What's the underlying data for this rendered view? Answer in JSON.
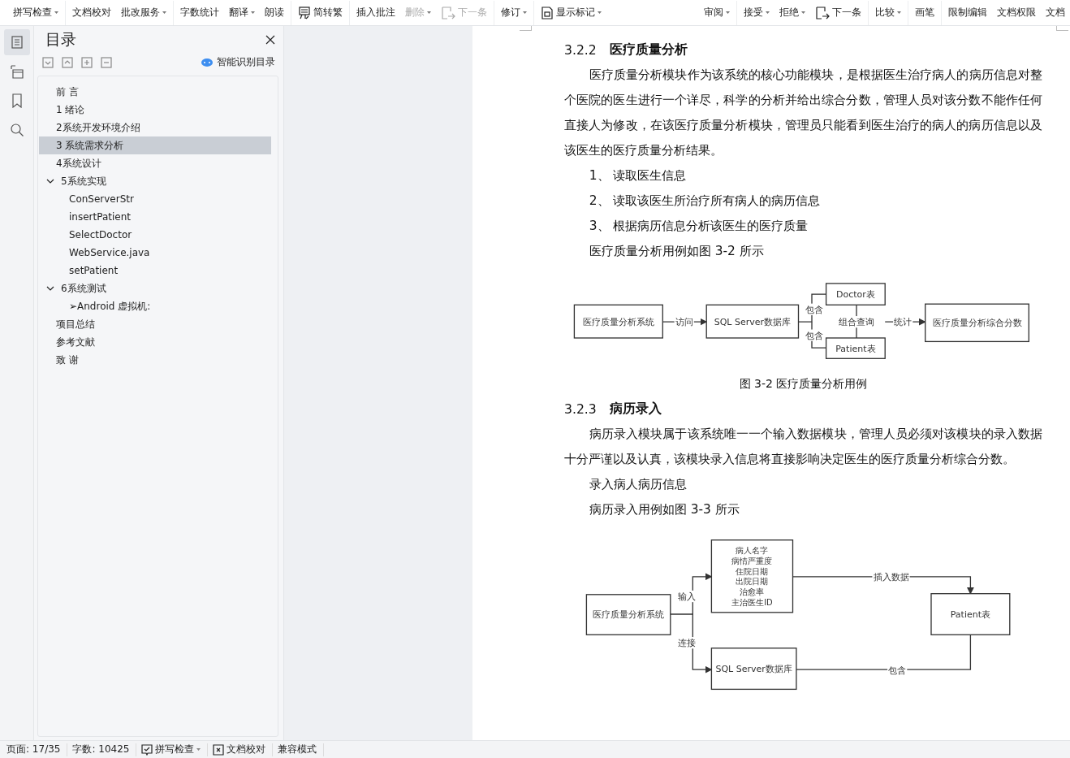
{
  "toolbar": {
    "left": [
      {
        "label": "拼写检查",
        "kind": "dropdown",
        "disabled": false
      },
      {
        "label": "文档校对",
        "kind": "plain",
        "disabled": false
      },
      {
        "label": "批改服务",
        "kind": "dropdown",
        "disabled": false
      },
      {
        "label": "字数统计",
        "kind": "plain",
        "disabled": false
      },
      {
        "label": "翻译",
        "kind": "dropdown",
        "disabled": false
      },
      {
        "label": "朗读",
        "kind": "plain",
        "disabled": false
      },
      {
        "label": "简转繁",
        "kind": "convert",
        "disabled": false
      },
      {
        "label": "插入批注",
        "kind": "plain",
        "disabled": false
      },
      {
        "label": "删除",
        "kind": "dropdown",
        "disabled": true
      },
      {
        "label": "下一条",
        "kind": "next",
        "disabled": true
      },
      {
        "label": "修订",
        "kind": "dropdown",
        "disabled": false
      },
      {
        "label": "显示标记",
        "kind": "markup",
        "disabled": false
      }
    ],
    "right": [
      {
        "label": "审阅",
        "kind": "dropdown",
        "disabled": false
      },
      {
        "label": "接受",
        "kind": "dropdown",
        "disabled": false
      },
      {
        "label": "拒绝",
        "kind": "dropdown",
        "disabled": false
      },
      {
        "label": "下一条",
        "kind": "next",
        "disabled": false
      },
      {
        "label": "比较",
        "kind": "dropdown",
        "disabled": false
      },
      {
        "label": "画笔",
        "kind": "plain",
        "disabled": false
      },
      {
        "label": "限制编辑",
        "kind": "plain",
        "disabled": false
      },
      {
        "label": "文档权限",
        "kind": "plain",
        "disabled": false
      },
      {
        "label": "文档",
        "kind": "plain",
        "disabled": false
      }
    ]
  },
  "rail": [
    {
      "kind": "outline",
      "selected": true
    },
    {
      "kind": "chapters",
      "selected": false
    },
    {
      "kind": "bookmark",
      "selected": false
    },
    {
      "kind": "search",
      "selected": false
    }
  ],
  "toc": {
    "title": "目录",
    "smart_label": "智能识别目录",
    "items": [
      {
        "label": "前 言",
        "selected": false
      },
      {
        "label": "1  绪论",
        "selected": false
      },
      {
        "label": "2系统开发环境介绍",
        "selected": false
      },
      {
        "label": "3  系统需求分析",
        "selected": true
      },
      {
        "label": "4系统设计",
        "selected": false
      },
      {
        "label": "5系统实现",
        "selected": false,
        "expanded": true,
        "children": [
          {
            "label": "ConServerStr",
            "selected": false
          },
          {
            "label": "insertPatient",
            "selected": false
          },
          {
            "label": "SelectDoctor",
            "selected": false
          },
          {
            "label": "WebService.java",
            "selected": false
          },
          {
            "label": "setPatient",
            "selected": false
          }
        ]
      },
      {
        "label": "6系统测试",
        "selected": false,
        "expanded": true,
        "children": [
          {
            "label": "➢Android 虚拟机:",
            "selected": false
          }
        ]
      },
      {
        "label": "项目总结",
        "selected": false
      },
      {
        "label": "参考文献",
        "selected": false
      },
      {
        "label": "致 谢",
        "selected": false
      }
    ]
  },
  "document": {
    "blocks": [
      {
        "kind": "heading",
        "number": "3.2.2",
        "title": "医疗质量分析"
      },
      {
        "kind": "paragraph",
        "text": "医疗质量分析模块作为该系统的核心功能模块，是根据医生治疗病人的病历信息对整个医院的医生进行一个详尽，科学的分析并给出综合分数，管理人员对该分数不能作任何直接人为修改，在该医疗质量分析模块，管理员只能看到医生治疗的病人的病历信息以及该医生的医疗质量分析结果。"
      },
      {
        "kind": "paragraph",
        "text": "1、 读取医生信息"
      },
      {
        "kind": "paragraph",
        "text": "2、 读取该医生所治疗所有病人的病历信息"
      },
      {
        "kind": "paragraph",
        "text": "3、 根据病历信息分析该医生的医疗质量"
      },
      {
        "kind": "paragraph",
        "text": "医疗质量分析用例如图 3-2 所示"
      },
      {
        "kind": "analysis_diagram",
        "nodes": [
          [
            "医疗质量分析系统"
          ],
          [
            "SQL Server数据库"
          ],
          [
            "Doctor表"
          ],
          [
            "Patient表"
          ],
          [
            "医疗质量分析综合分数"
          ]
        ],
        "edge_labels": [
          "访问",
          "包含",
          "包含",
          "组合查询",
          "统计"
        ]
      },
      {
        "kind": "caption",
        "text": "图 3-2 医疗质量分析用例"
      },
      {
        "kind": "heading",
        "number": "3.2.3",
        "title": "病历录入"
      },
      {
        "kind": "paragraph",
        "text": "病历录入模块属于该系统唯一一个输入数据模块，管理人员必须对该模块的录入数据十分严谨以及认真，该模块录入信息将直接影响决定医生的医疗质量分析综合分数。"
      },
      {
        "kind": "paragraph",
        "text": "录入病人病历信息"
      },
      {
        "kind": "paragraph",
        "text": "病历录入用例如图 3-3 所示"
      },
      {
        "kind": "entry_diagram",
        "nodes": [
          [
            "医疗质量分析系统"
          ],
          [
            "病人名字",
            "病情严重度",
            "住院日期",
            "出院日期",
            "治愈率",
            "主治医生ID"
          ],
          [
            "Patient表"
          ],
          [
            "SQL Server数据库"
          ]
        ],
        "edge_labels": [
          "输入",
          "连接",
          "插入数据",
          "包含"
        ]
      }
    ]
  },
  "status_bar": {
    "page": "页面: 17/35",
    "words": "字数: 10425",
    "spell": "拼写检查",
    "proof": "文档校对",
    "mode": "兼容模式"
  }
}
